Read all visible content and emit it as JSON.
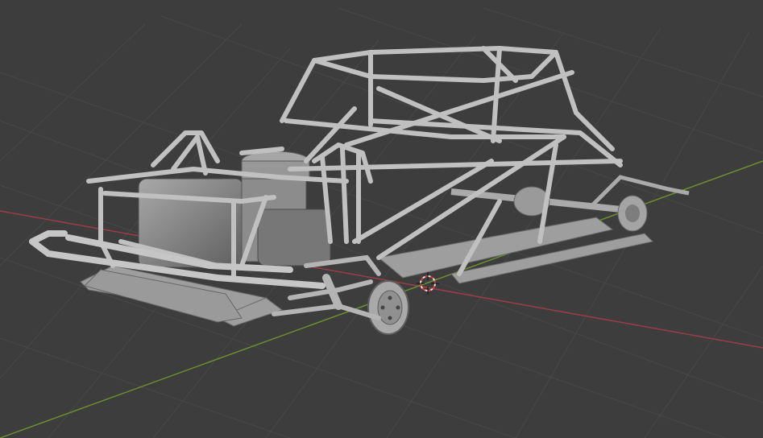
{
  "viewport": {
    "background": "#3d3d3d",
    "grid_color": "#4a4a4a",
    "x_axis_color": "#a8434f",
    "y_axis_color": "#6f9a2e"
  },
  "scene": {
    "object": "race-car-chassis",
    "material_color": "#b9b9b9",
    "cursor": "3d-cursor-icon"
  }
}
